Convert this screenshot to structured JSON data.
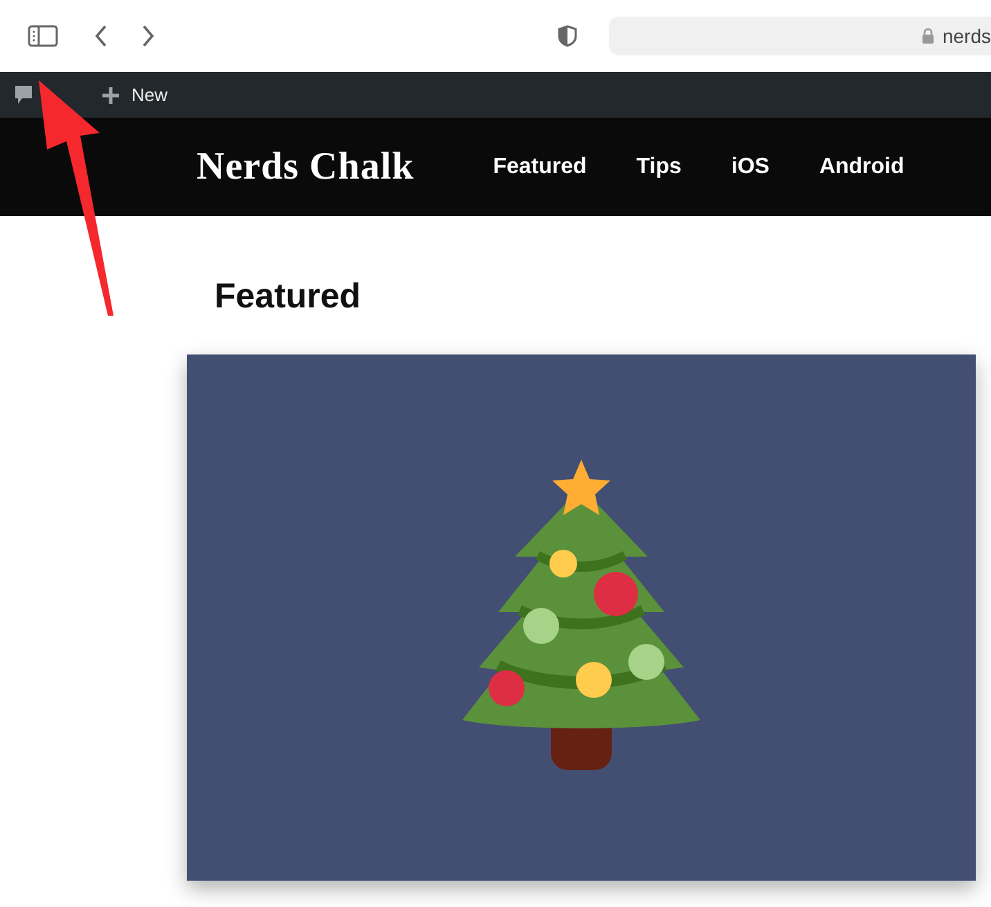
{
  "browser": {
    "address": "nerds"
  },
  "admin_bar": {
    "new_label": "New"
  },
  "site": {
    "logo": "Nerds Chalk",
    "nav": [
      {
        "label": "Featured"
      },
      {
        "label": "Tips"
      },
      {
        "label": "iOS"
      },
      {
        "label": "Android"
      }
    ]
  },
  "section_title": "Featured"
}
